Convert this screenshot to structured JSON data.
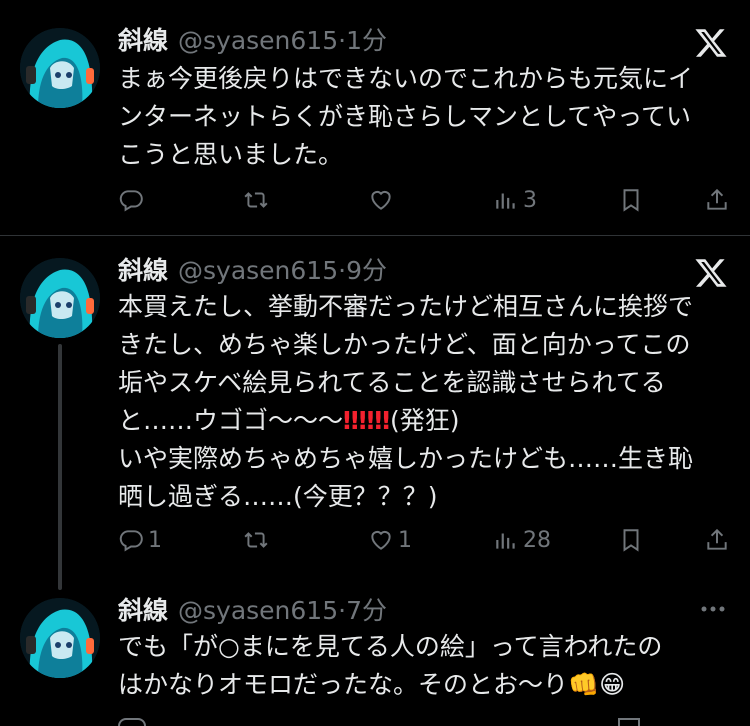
{
  "tweets": [
    {
      "name": "斜線",
      "handle": "@syasen615",
      "time": "1分",
      "lines": [
        "まぁ今更後戻りはできないのでこれからも元気にイ",
        "ンターネットらくがき恥さらしマンとしてやってい",
        "こうと思いました。"
      ],
      "reply_count": "",
      "repost_count": "",
      "like_count": "",
      "view_count": "3"
    },
    {
      "name": "斜線",
      "handle": "@syasen615",
      "time": "9分",
      "lines": [
        "本買えたし、挙動不審だったけど相互さんに挨拶で",
        "きたし、めちゃ楽しかったけど、面と向かってこの",
        "垢やスケベ絵見られてることを認識させられてる",
        "いや実際めちゃめちゃ嬉しかったけども……生き恥",
        "晒し過ぎる……(今更？？？)"
      ],
      "line4_prefix": "と……ウゴゴ〜〜〜",
      "line4_bangs": "‼‼‼",
      "line4_suffix": "(発狂)",
      "reply_count": "1",
      "repost_count": "",
      "like_count": "1",
      "view_count": "28"
    },
    {
      "name": "斜線",
      "handle": "@syasen615",
      "time": "7分",
      "lines": [
        "でも「が○まにを見てる人の絵」って言われたの",
        "はかなりオモロだったな。そのとお〜り"
      ],
      "emojis": [
        "👊",
        "😁"
      ]
    }
  ],
  "icons": {
    "reply": "reply-icon",
    "repost": "repost-icon",
    "like": "heart-icon",
    "views": "views-icon",
    "bookmark": "bookmark-icon",
    "share": "share-icon",
    "brand": "x-logo-icon",
    "more": "more-icon"
  },
  "colors": {
    "background": "#000000",
    "text": "#e7e9ea",
    "muted": "#71767b",
    "divider": "#2f3336",
    "alert": "#f4212e"
  }
}
